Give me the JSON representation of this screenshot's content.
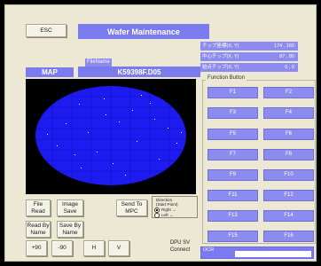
{
  "header": {
    "esc_label": "ESC",
    "title": "Wafer Maintenance"
  },
  "map": {
    "map_label": "MAP",
    "filename_label": "FileName",
    "filename": "K59398F.D05"
  },
  "info": {
    "rows": [
      {
        "label": "チップ座標(X, Y)",
        "value": "174 , 160"
      },
      {
        "label": "中心チップ(X, Y)",
        "value": "87 , 80"
      },
      {
        "label": "始点チップ(X, Y)",
        "value": "0 , 0"
      }
    ]
  },
  "function_panel": {
    "title": "Function Button",
    "buttons": [
      "F1",
      "F2",
      "F3",
      "F4",
      "F5",
      "F6",
      "F7",
      "F8",
      "F9",
      "F10",
      "F11",
      "F12",
      "F13",
      "F14",
      "F15",
      "F16"
    ]
  },
  "actions": {
    "file_read": "File Read",
    "image_save": "Image Save",
    "send_to_mpc": "Send To MPC",
    "read_by_name": "Read By Name",
    "save_by_name": "Save By Name"
  },
  "direction": {
    "label": "Direction (Start Point)",
    "right": "Right →",
    "left": "Left ←",
    "selected": "Right"
  },
  "bottom": {
    "rot_plus90": "+90",
    "rot_minus90": "-90",
    "h": "H",
    "v": "V",
    "dpu_connect": "DPU SV Connect",
    "ocr_label": "OCR"
  },
  "colors": {
    "panel_bg": "#ece8d4",
    "accent_blue": "#7b7bf0",
    "wafer_blue": "#1d1bf0",
    "map_bg": "#000000"
  }
}
